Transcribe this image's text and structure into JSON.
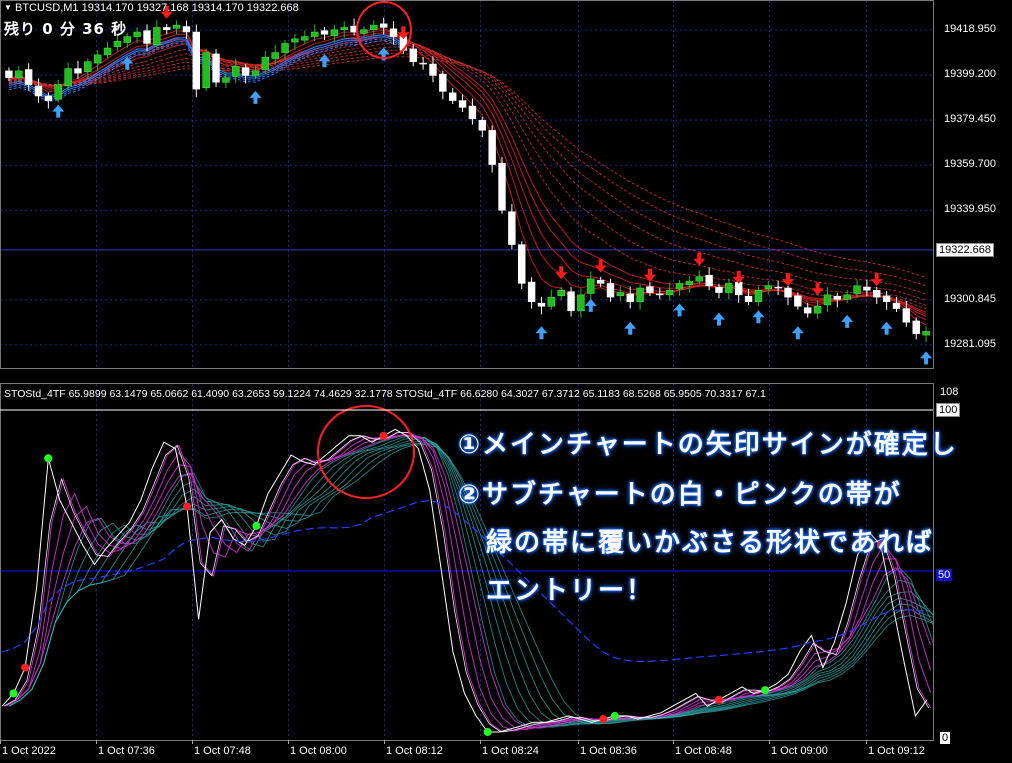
{
  "main_chart": {
    "symbol_line": "BTCUSD,M1  19314.170 19327.168 19314.170 19322.668",
    "timer_text": "残り 0 分 36 秒",
    "price_labels": [
      "19418.950",
      "19399.200",
      "19379.450",
      "19359.700",
      "19339.950",
      "19300.845",
      "19281.095"
    ],
    "current_price": "19322.668",
    "price_range": [
      19271,
      19432
    ],
    "closes": [
      19398,
      19401,
      19395,
      19390,
      19388,
      19395,
      19402,
      19400,
      19405,
      19408,
      19411,
      19414,
      19416,
      19418,
      19413,
      19420,
      19419,
      19421,
      19418,
      19393,
      19409,
      19396,
      19398,
      19403,
      19399,
      19401,
      19407,
      19409,
      19413,
      19415,
      19416,
      19418,
      19417,
      19419,
      19420,
      19418,
      19419,
      19421,
      19420,
      19416,
      19410,
      19405,
      19404,
      19399,
      19392,
      19388,
      19385,
      19380,
      19375,
      19360,
      19340,
      19325,
      19308,
      19300,
      19298,
      19302,
      19305,
      19296,
      19303,
      19310,
      19308,
      19302,
      19304,
      19300,
      19306,
      19304,
      19303,
      19305,
      19308,
      19309,
      19311,
      19307,
      19304,
      19308,
      19303,
      19300,
      19305,
      19307,
      19306,
      19302,
      19298,
      19295,
      19298,
      19303,
      19301,
      19303,
      19307,
      19305,
      19302,
      19300,
      19297,
      19291,
      19286,
      19287
    ],
    "arrows_up": [
      5,
      12,
      25,
      32,
      38,
      54,
      59,
      63,
      68,
      72,
      76,
      80,
      85,
      89,
      93
    ],
    "arrows_down": [
      16,
      40,
      56,
      60,
      65,
      70,
      74,
      79,
      82,
      88
    ]
  },
  "sub_chart": {
    "indicator_line": "STOStd_4TF 65.9899 63.1479 65.0662 61.4090 63.2653 59.1224 74.4629 32.1778   STOStd_4TF 66.6280 64.3027 67.3712 65.1183 68.5268 65.9505 70.3317 67.1",
    "scale_labels": [
      "108",
      "100",
      "50",
      "0"
    ],
    "level_value": 50,
    "stoch_values": [
      8,
      12,
      20,
      45,
      85,
      72,
      65,
      58,
      52,
      57,
      61,
      65,
      72,
      82,
      90,
      88,
      70,
      35,
      62,
      66,
      60,
      58,
      64,
      74,
      80,
      86,
      84,
      83,
      86,
      89,
      92,
      92,
      90,
      92,
      94,
      92,
      88,
      75,
      50,
      25,
      12,
      5,
      0,
      0,
      1,
      2,
      3,
      3,
      4,
      5,
      4,
      3,
      4,
      5,
      5,
      4,
      5,
      6,
      8,
      10,
      12,
      8,
      10,
      12,
      14,
      12,
      13,
      15,
      18,
      25,
      30,
      20,
      28,
      40,
      55,
      62,
      58,
      40,
      22,
      5,
      10
    ],
    "green_dots": [
      1,
      7,
      36,
      68,
      86,
      108
    ],
    "red_dots": [
      4,
      26,
      53,
      84,
      100,
      123
    ]
  },
  "time_labels": [
    "1 Oct 2022",
    "1 Oct 07:36",
    "1 Oct 07:48",
    "1 Oct 08:00",
    "1 Oct 08:12",
    "1 Oct 08:24",
    "1 Oct 08:36",
    "1 Oct 08:48",
    "1 Oct 09:00",
    "1 Oct 09:12"
  ],
  "annotation": {
    "line1": "①メインチャートの矢印サインが確定し",
    "line2": "②サブチャートの白・ピンクの帯が",
    "line3": "緑の帯に覆いかぶさる形状であれば",
    "line4": "エントリー！"
  },
  "colors": {
    "background": "#000000",
    "grid": "#1a2a8a",
    "bull_candle": "#22bb22",
    "bear_candle": "#ffffff",
    "red_ribbon": "#e02020",
    "blue_ribbon": "#2c7dff",
    "up_arrow": "#3ea0ff",
    "down_arrow": "#ff1a1a",
    "highlight_circle": "#ff2020",
    "magenta_band": "#cc33cc",
    "teal_band": "#2fb0b0",
    "level_line": "#1010cc"
  }
}
